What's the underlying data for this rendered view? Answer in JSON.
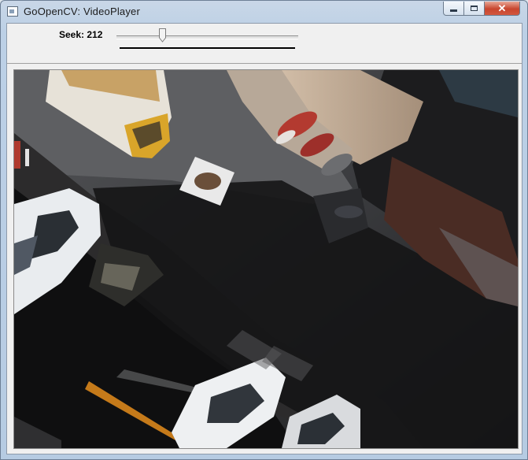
{
  "window": {
    "title": "GoOpenCV: VideoPlayer",
    "icon": "app-window-icon",
    "controls": {
      "minimize": "minimize-icon",
      "maximize": "maximize-icon",
      "close_symbol": "✕"
    }
  },
  "toolbar": {
    "seek_label": "Seek: 212",
    "seek_value": 212
  },
  "video": {
    "description_icon": "video-frame",
    "colors": {
      "road": "#3c3c3e",
      "shadow": "#0a0a0c",
      "car": "#e8eaec",
      "truck_yellow": "#d9a52a"
    }
  }
}
